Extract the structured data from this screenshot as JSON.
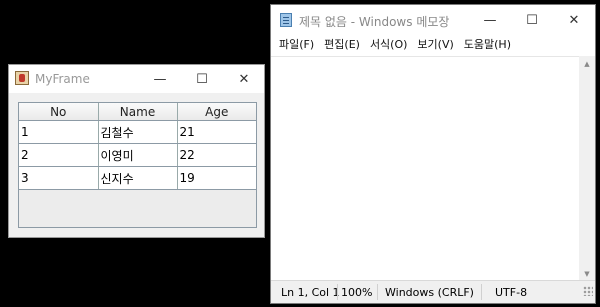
{
  "myframe": {
    "title": "MyFrame",
    "controls": {
      "minimize": "—",
      "maximize": "☐",
      "close": "✕"
    },
    "table": {
      "columns": [
        "No",
        "Name",
        "Age"
      ],
      "rows": [
        [
          "1",
          "김철수",
          "21"
        ],
        [
          "2",
          "이영미",
          "22"
        ],
        [
          "3",
          "신지수",
          "19"
        ]
      ]
    }
  },
  "notepad": {
    "title": "제목 없음 - Windows 메모장",
    "controls": {
      "minimize": "—",
      "maximize": "☐",
      "close": "✕"
    },
    "menu": [
      "파일(F)",
      "편집(E)",
      "서식(O)",
      "보기(V)",
      "도움말(H)"
    ],
    "status": {
      "position": "Ln 1, Col 1",
      "zoom": "100%",
      "line_ending": "Windows (CRLF)",
      "encoding": "UTF-8"
    },
    "scrollbar": {
      "up": "▲",
      "down": "▼"
    }
  }
}
